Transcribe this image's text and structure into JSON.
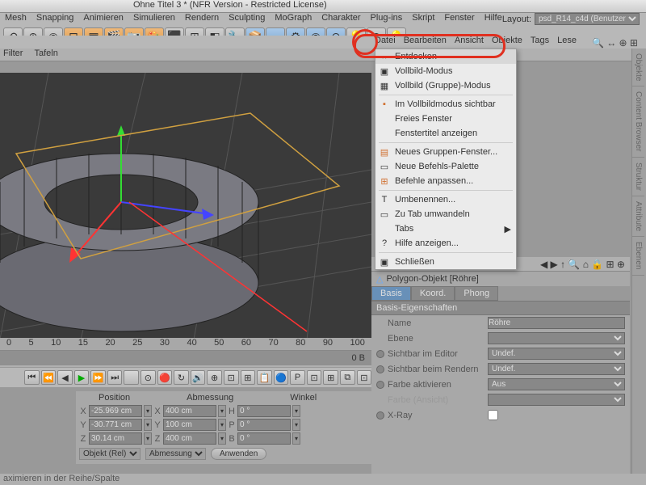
{
  "title": "Ohne Titel 3 * (NFR Version - Restricted License)",
  "menubar": [
    "Mesh",
    "Snapping",
    "Animieren",
    "Simulieren",
    "Rendern",
    "Sculpting",
    "MoGraph",
    "Charakter",
    "Plug-ins",
    "Skript",
    "Fenster",
    "Hilfe"
  ],
  "layout_label": "Layout:",
  "layout_value": "psd_R14_c4d (Benutzer)",
  "sub_menubar": [
    "Datei",
    "Bearbeiten",
    "Ansicht",
    "Objekte",
    "Tags",
    "Lese"
  ],
  "tab_row": [
    "Filter",
    "Tafeln"
  ],
  "context_menu": [
    {
      "label": "Entdocken",
      "sel": true,
      "ico": "↔"
    },
    {
      "label": "Vollbild-Modus",
      "ico": "▣"
    },
    {
      "label": "Vollbild (Gruppe)-Modus",
      "ico": "▦"
    },
    {
      "sep": true
    },
    {
      "label": "Im Vollbildmodus sichtbar",
      "ico": "▪",
      "icocolor": "#d07030"
    },
    {
      "label": "Freies Fenster"
    },
    {
      "label": "Fenstertitel anzeigen",
      "dis": true
    },
    {
      "sep": true
    },
    {
      "label": "Neues Gruppen-Fenster...",
      "ico": "▤",
      "icocolor": "#d07030"
    },
    {
      "label": "Neue Befehls-Palette",
      "ico": "▭"
    },
    {
      "label": "Befehle anpassen...",
      "ico": "⊞",
      "icocolor": "#d07030"
    },
    {
      "sep": true
    },
    {
      "label": "Umbenennen...",
      "ico": "T"
    },
    {
      "label": "Zu Tab umwandeln",
      "dis": true,
      "ico": "▭"
    },
    {
      "label": "Tabs",
      "arrow": true
    },
    {
      "label": "Hilfe anzeigen...",
      "ico": "?"
    },
    {
      "sep": true
    },
    {
      "label": "Schließen",
      "ico": "▣"
    }
  ],
  "ruler": [
    "0",
    "5",
    "10",
    "15",
    "20",
    "25",
    "30",
    "40",
    "50",
    "60",
    "70",
    "80",
    "90",
    "100"
  ],
  "ruler_end": "0 B",
  "coords": {
    "headers": [
      "Position",
      "Abmessung",
      "Winkel"
    ],
    "rows": [
      {
        "l": "X",
        "v": "-25.969 cm",
        "l2": "X",
        "v2": "400 cm",
        "l3": "H",
        "v3": "0 °"
      },
      {
        "l": "Y",
        "v": "-30.771 cm",
        "l2": "Y",
        "v2": "100 cm",
        "l3": "P",
        "v3": "0 °"
      },
      {
        "l": "Z",
        "v": "30.14 cm",
        "l2": "Z",
        "v2": "400 cm",
        "l3": "B",
        "v3": "0 °"
      }
    ],
    "sel1": "Objekt (Rel)",
    "sel2": "Abmessung",
    "btn": "Anwenden"
  },
  "right": {
    "object": "Polygon-Objekt [Röhre]",
    "tabs": [
      "Basis",
      "Koord.",
      "Phong"
    ],
    "section": "Basis-Eigenschaften",
    "rows": [
      {
        "label": "Name",
        "val": "Röhre",
        "type": "input"
      },
      {
        "label": "Ebene",
        "val": "",
        "type": "select"
      },
      {
        "label": "Sichtbar im Editor",
        "val": "Undef.",
        "type": "select",
        "dot": true
      },
      {
        "label": "Sichtbar beim Rendern",
        "val": "Undef.",
        "type": "select",
        "dot": true
      },
      {
        "label": "Farbe aktivieren",
        "val": "Aus",
        "type": "select",
        "dot": true
      },
      {
        "label": "Farbe (Ansicht)",
        "val": "",
        "type": "select",
        "dis": true
      },
      {
        "label": "X-Ray",
        "val": "",
        "type": "check",
        "dot": true
      }
    ]
  },
  "sidebar": [
    "Objekte",
    "Content Browser",
    "Struktur",
    "Attribute",
    "Ebenen"
  ],
  "status": "aximieren in der Reihe/Spalte"
}
